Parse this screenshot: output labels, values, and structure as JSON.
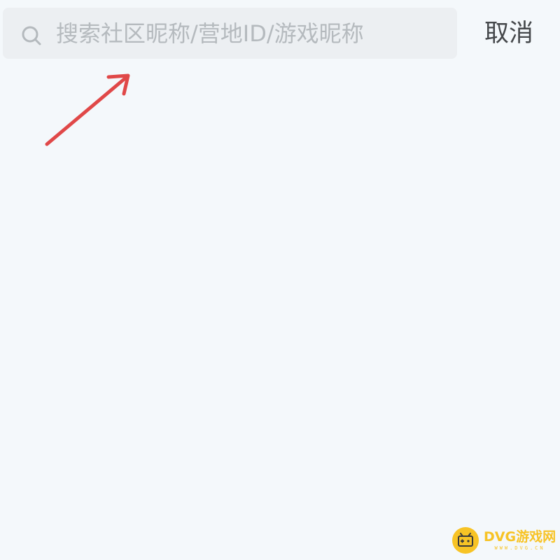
{
  "search": {
    "placeholder": "搜索社区昵称/营地ID/游戏昵称",
    "value": ""
  },
  "header": {
    "cancel_label": "取消"
  },
  "annotation": {
    "color": "#e04848"
  },
  "watermark": {
    "name": "DVG游戏网",
    "url": "WWW.DVG.CN",
    "color": "#f7c325"
  }
}
